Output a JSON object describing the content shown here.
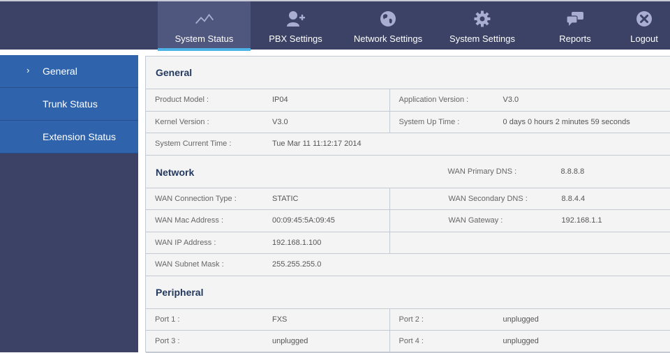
{
  "nav": {
    "items": [
      {
        "label": "System Status",
        "icon": "chart-line-icon",
        "active": true
      },
      {
        "label": "PBX Settings",
        "icon": "user-add-icon"
      },
      {
        "label": "Network Settings",
        "icon": "globe-icon"
      },
      {
        "label": "System Settings",
        "icon": "gear-icon"
      },
      {
        "label": "Reports",
        "icon": "chat-bubbles-icon"
      },
      {
        "label": "Logout",
        "icon": "close-circle-icon"
      }
    ]
  },
  "sidebar": {
    "items": [
      {
        "label": "General",
        "active": true,
        "chevron": "›"
      },
      {
        "label": "Trunk Status"
      },
      {
        "label": "Extension Status"
      }
    ]
  },
  "general": {
    "title": "General",
    "product_model": {
      "label": "Product Model :",
      "value": "IP04"
    },
    "application_version": {
      "label": "Application Version :",
      "value": "V3.0"
    },
    "kernel_version": {
      "label": "Kernel Version :",
      "value": "V3.0"
    },
    "system_up_time": {
      "label": "System Up Time :",
      "value": "0 days 0 hours 2 minutes 59 seconds"
    },
    "system_current_time": {
      "label": "System Current Time :",
      "value": "Tue Mar 11 11:12:17 2014"
    }
  },
  "network": {
    "title": "Network",
    "wan_primary_dns": {
      "label": "WAN Primary DNS :",
      "value": "8.8.8.8"
    },
    "wan_connection_type": {
      "label": "WAN Connection Type :",
      "value": "STATIC"
    },
    "wan_secondary_dns": {
      "label": "WAN Secondary DNS :",
      "value": "8.8.4.4"
    },
    "wan_mac_address": {
      "label": "WAN Mac Address :",
      "value": "00:09:45:5A:09:45"
    },
    "wan_gateway": {
      "label": "WAN Gateway :",
      "value": "192.168.1.1"
    },
    "wan_ip_address": {
      "label": "WAN IP Address :",
      "value": "192.168.1.100"
    },
    "wan_subnet_mask": {
      "label": "WAN Subnet Mask :",
      "value": "255.255.255.0"
    }
  },
  "peripheral": {
    "title": "Peripheral",
    "port1": {
      "label": "Port 1 :",
      "value": "FXS"
    },
    "port2": {
      "label": "Port 2 :",
      "value": "unplugged"
    },
    "port3": {
      "label": "Port 3 :",
      "value": "unplugged"
    },
    "port4": {
      "label": "Port 4 :",
      "value": "unplugged"
    }
  },
  "colors": {
    "header_bg": "#3b4265",
    "active_tab_bg": "#50577f",
    "active_tab_underline": "#4db3e6",
    "sidebar_item_bg": "#2f64ad",
    "section_title": "#24395f"
  }
}
